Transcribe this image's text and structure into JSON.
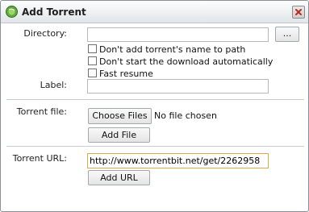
{
  "dialog": {
    "title": "Add Torrent"
  },
  "directory": {
    "label": "Directory:",
    "value": "",
    "browse_label": "..."
  },
  "options": [
    {
      "label": "Don't add torrent's name to path",
      "checked": false
    },
    {
      "label": "Don't start the download automatically",
      "checked": false
    },
    {
      "label": "Fast resume",
      "checked": false
    }
  ],
  "label_field": {
    "label": "Label:",
    "value": ""
  },
  "torrent_file": {
    "label": "Torrent file:",
    "choose_label": "Choose Files",
    "status": "No file chosen",
    "add_label": "Add File"
  },
  "torrent_url": {
    "label": "Torrent URL:",
    "value": "http://www.torrentbit.net/get/2262958",
    "add_label": "Add URL"
  }
}
